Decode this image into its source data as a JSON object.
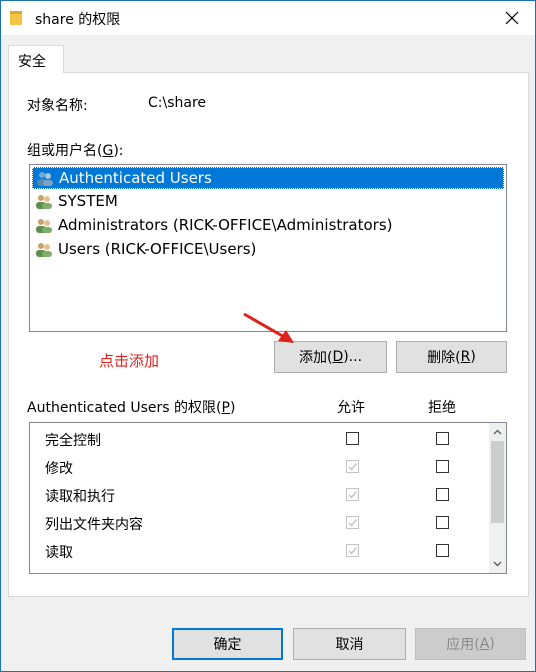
{
  "window": {
    "title": "share 的权限"
  },
  "tabs": [
    {
      "label": "安全"
    }
  ],
  "object": {
    "label": "对象名称:",
    "value": "C:\\share"
  },
  "group_section": {
    "label_pre": "组或用户名(",
    "label_key": "G",
    "label_post": "):"
  },
  "users": [
    {
      "name": "Authenticated Users",
      "selected": true
    },
    {
      "name": "SYSTEM",
      "selected": false
    },
    {
      "name": "Administrators (RICK-OFFICE\\Administrators)",
      "selected": false
    },
    {
      "name": "Users (RICK-OFFICE\\Users)",
      "selected": false
    }
  ],
  "hint": {
    "text": "点击添加"
  },
  "buttons": {
    "add": {
      "pre": "添加(",
      "key": "D",
      "post": ")..."
    },
    "remove": {
      "pre": "删除(",
      "key": "R",
      "post": ")"
    },
    "ok": {
      "label": "确定"
    },
    "cancel": {
      "label": "取消"
    },
    "apply": {
      "pre": "应用(",
      "key": "A",
      "post": ")"
    }
  },
  "permissions": {
    "label_pre": "Authenticated Users 的权限(",
    "label_key": "P",
    "label_post": ")",
    "allow_header": "允许",
    "deny_header": "拒绝",
    "rows": [
      {
        "name": "完全控制",
        "allow": false,
        "allow_disabled": false,
        "deny": false
      },
      {
        "name": "修改",
        "allow": true,
        "allow_disabled": true,
        "deny": false
      },
      {
        "name": "读取和执行",
        "allow": true,
        "allow_disabled": true,
        "deny": false
      },
      {
        "name": "列出文件夹内容",
        "allow": true,
        "allow_disabled": true,
        "deny": false
      },
      {
        "name": "读取",
        "allow": true,
        "allow_disabled": true,
        "deny": false
      }
    ]
  },
  "colors": {
    "accent": "#0078d7",
    "hint": "#e0201b",
    "arrow": "#e0201b"
  }
}
